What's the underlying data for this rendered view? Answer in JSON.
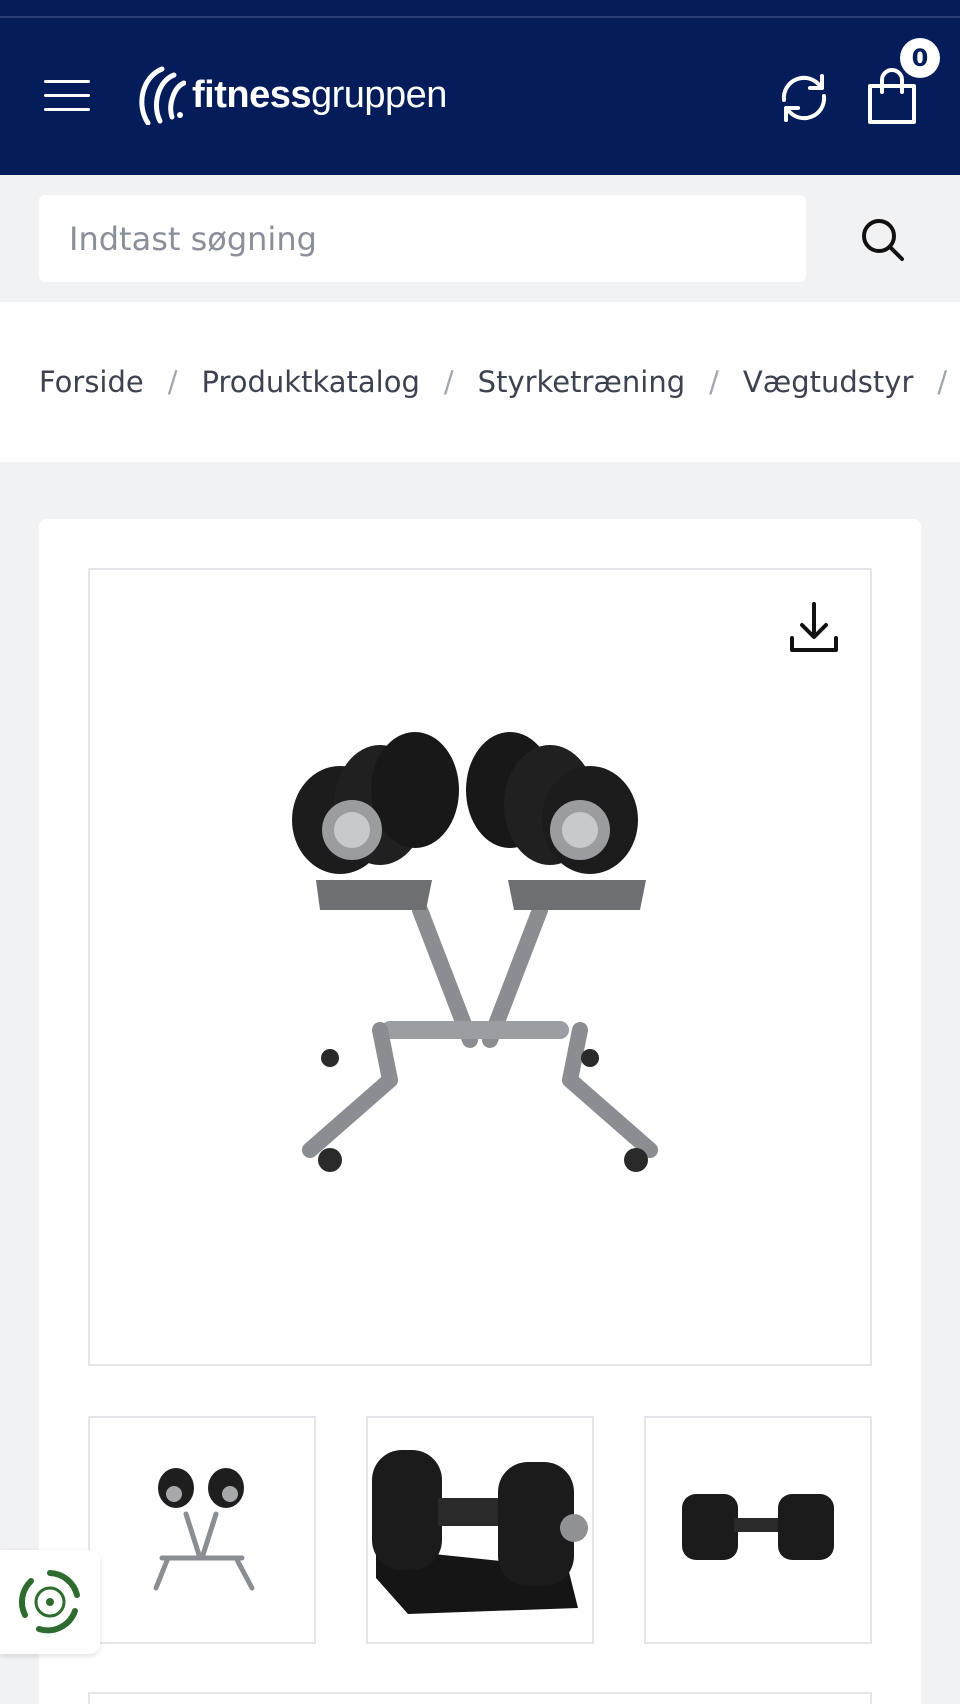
{
  "header": {
    "logo_bold": "fitness",
    "logo_light": "gruppen",
    "cart_count": "0",
    "icons": [
      "hamburger-menu-icon",
      "refresh-icon",
      "shopping-bag-icon"
    ]
  },
  "search": {
    "placeholder": "Indtast søgning",
    "value": ""
  },
  "breadcrumb": {
    "items": [
      "Forside",
      "Produktkatalog",
      "Styrketræning",
      "Vægtudstyr"
    ],
    "separator": "/"
  },
  "product_gallery": {
    "main_image": "adjustable-dumbbells-on-stand",
    "thumbnails": [
      "dumbbells-on-stand",
      "single-adjustable-dumbbell-in-tray",
      "adjustable-dumbbell-side-view"
    ]
  },
  "colors": {
    "header_bg": "#041d5a",
    "page_bg": "#f1f2f4",
    "eco_green": "#2e6b2f"
  }
}
